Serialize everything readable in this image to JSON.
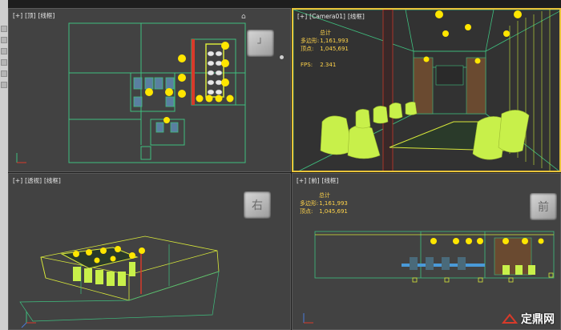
{
  "viewports": {
    "top": {
      "plus": "[+]",
      "view": "[顶]",
      "shading": "[线框]"
    },
    "camera": {
      "plus": "[+]",
      "view": "[Camera01]",
      "shading": "[线框]",
      "stats": {
        "total": "总计",
        "poly_label": "多边形:",
        "poly_value": "1,161,993",
        "vert_label": "顶点:",
        "vert_value": "1,045,691",
        "fps_label": "FPS:",
        "fps_value": "2.341"
      }
    },
    "perspective": {
      "plus": "[+]",
      "view": "[透视]",
      "shading": "[线框]",
      "cube_label": "右"
    },
    "front": {
      "plus": "[+]",
      "view": "[前]",
      "shading": "[线框]",
      "cube_label": "前",
      "stats": {
        "total": "总计",
        "poly_label": "多边形:",
        "poly_value": "1,161,993",
        "vert_label": "顶点:",
        "vert_value": "1,045,691"
      }
    }
  },
  "watermark": {
    "text": "定鼎网"
  },
  "colors": {
    "wire_green": "#3fbf7f",
    "wire_yellow": "#d8e83a",
    "chair": "#c8f04a",
    "light": "#ffe600",
    "border_active": "#e8c33a",
    "viewport_bg": "#424242"
  }
}
